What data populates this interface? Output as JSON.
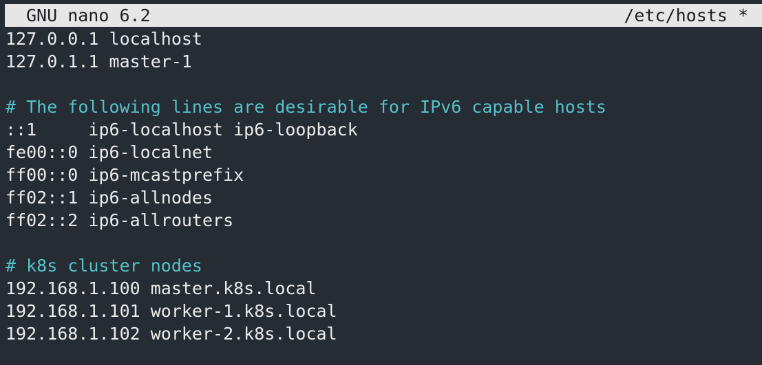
{
  "titlebar": {
    "app": "GNU nano 6.2",
    "file": "/etc/hosts *"
  },
  "colors": {
    "background": "#252c33",
    "titlebar_bg": "#e6e6e6",
    "titlebar_fg": "#1d1f22",
    "text": "#ebebeb",
    "comment": "#56c1c8"
  },
  "editor": {
    "lines": [
      {
        "text": "127.0.0.1 localhost",
        "kind": "normal"
      },
      {
        "text": "127.0.1.1 master-1",
        "kind": "normal"
      },
      {
        "text": "",
        "kind": "normal"
      },
      {
        "text": "# The following lines are desirable for IPv6 capable hosts",
        "kind": "comment"
      },
      {
        "text": "::1     ip6-localhost ip6-loopback",
        "kind": "normal"
      },
      {
        "text": "fe00::0 ip6-localnet",
        "kind": "normal"
      },
      {
        "text": "ff00::0 ip6-mcastprefix",
        "kind": "normal"
      },
      {
        "text": "ff02::1 ip6-allnodes",
        "kind": "normal"
      },
      {
        "text": "ff02::2 ip6-allrouters",
        "kind": "normal"
      },
      {
        "text": "",
        "kind": "normal"
      },
      {
        "text": "# k8s cluster nodes",
        "kind": "comment"
      },
      {
        "text": "192.168.1.100 master.k8s.local",
        "kind": "normal"
      },
      {
        "text": "192.168.1.101 worker-1.k8s.local",
        "kind": "normal"
      },
      {
        "text": "192.168.1.102 worker-2.k8s.local",
        "kind": "normal"
      }
    ]
  }
}
